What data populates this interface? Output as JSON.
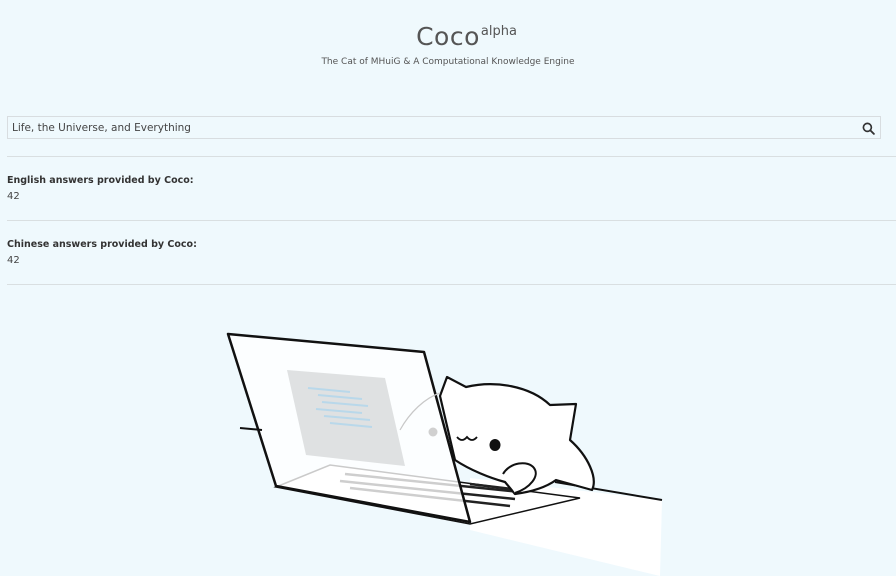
{
  "header": {
    "title": "Coco",
    "title_superscript": "alpha",
    "subtitle": "The Cat of MHuiG & A Computational Knowledge Engine"
  },
  "search": {
    "value": "Life, the Universe, and Everything",
    "icon": "search-icon"
  },
  "answers": [
    {
      "label": "English answers provided by Coco:",
      "value": "42"
    },
    {
      "label": "Chinese answers provided by Coco:",
      "value": "42"
    }
  ],
  "illustration": {
    "description_icon": "cat-typing-on-laptop-illustration"
  },
  "colors": {
    "background": "#eff9fd",
    "text": "#333333",
    "divider": "#d9dfe1"
  }
}
